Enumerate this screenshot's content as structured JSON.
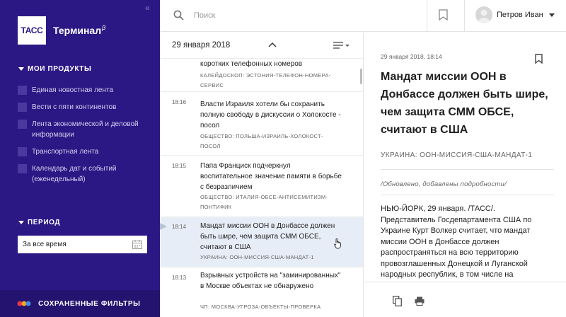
{
  "sidebar": {
    "collapse_glyph": "«",
    "logo_text": "ТАСС",
    "app_title": "Терминал",
    "app_beta": "β",
    "products_header": "МОИ ПРОДУКТЫ",
    "products": [
      {
        "label": "Единая новостная лента"
      },
      {
        "label": "Вести с пяти континентов"
      },
      {
        "label": "Лента экономической и деловой информации"
      },
      {
        "label": "Транспортная лента"
      },
      {
        "label": "Календарь дат и событий (еженедельный)"
      }
    ],
    "period_header": "ПЕРИОД",
    "period_value": "За все время",
    "saved_filters_label": "СОХРАНЕННЫЕ ФИЛЬТРЫ"
  },
  "topbar": {
    "search_placeholder": "Поиск",
    "user_name": "Петров Иван"
  },
  "feed": {
    "date": "29 января 2018",
    "items": [
      {
        "time": "",
        "headline": "коротких телефонных номеров",
        "tags": "КАЛЕЙДОСКОП: ЭСТОНИЯ-ТЕЛЕФОН-НОМЕРА-СЕРВИС",
        "active": false
      },
      {
        "time": "18:16",
        "headline": "Власти Израиля хотели бы сохранить полную свободу в дискуссии о Холокосте - посол",
        "tags": "ОБЩЕСТВО: ПОЛЬША-ИЗРАИЛЬ-ХОЛОКОСТ-ПОСОЛ",
        "active": false
      },
      {
        "time": "18:15",
        "headline": "Папа Франциск подчеркнул воспитательное значение памяти в борьбе с безразличием",
        "tags": "ОБЩЕСТВО: ИТАЛИЯ-ОБСЕ-АНТИСЕМИТИЗМ-ПОНТИФИК",
        "active": false
      },
      {
        "time": "18:14",
        "headline": "Мандат миссии ООН в Донбассе должен быть шире, чем защита СММ ОБСЕ, считают в США",
        "tags": "УКРАИНА: ООН-МИССИЯ-США-МАНДАТ-1",
        "active": true
      },
      {
        "time": "18:13",
        "headline": "Взрывных устройств на \"заминированных\" в Москве объектах не обнаружено",
        "tags": "ЧП: МОСКВА-УГРОЗА-ОБЪЕКТЫ-ПРОВЕРКА",
        "active": false
      }
    ]
  },
  "article": {
    "datetime": "29 января 2018, 18:14",
    "title": "Мандат миссии ООН в Донбассе должен быть шире, чем защита СММ ОБСЕ, считают в США",
    "tags": "УКРАИНА: ООН-МИССИЯ-США-МАНДАТ-1",
    "updated_note": "/Обновлено, добавлены подробности/",
    "body": "НЬЮ-ЙОРК, 29 января. /ТАСС/. Представитель Госдепартамента США по Украине Курт Волкер считает, что мандат миссии ООН в Донбассе должен распространяться на всю территорию провозглашенных Донецкой и Луганской народных республик, в том числе на"
  },
  "colors": {
    "sidebar_bg": "#2b1884",
    "active_row": "#e7edf6",
    "brand_dots": [
      "#e8394a",
      "#f5a623",
      "#3f8be0"
    ]
  },
  "icons": [
    "collapse-icon",
    "search-icon",
    "bookmark-icon",
    "avatar",
    "caret-down-icon",
    "chevron-up-icon",
    "sort-icon",
    "calendar-icon",
    "brand-dots-icon",
    "copy-icon",
    "print-icon",
    "cursor-icon"
  ]
}
